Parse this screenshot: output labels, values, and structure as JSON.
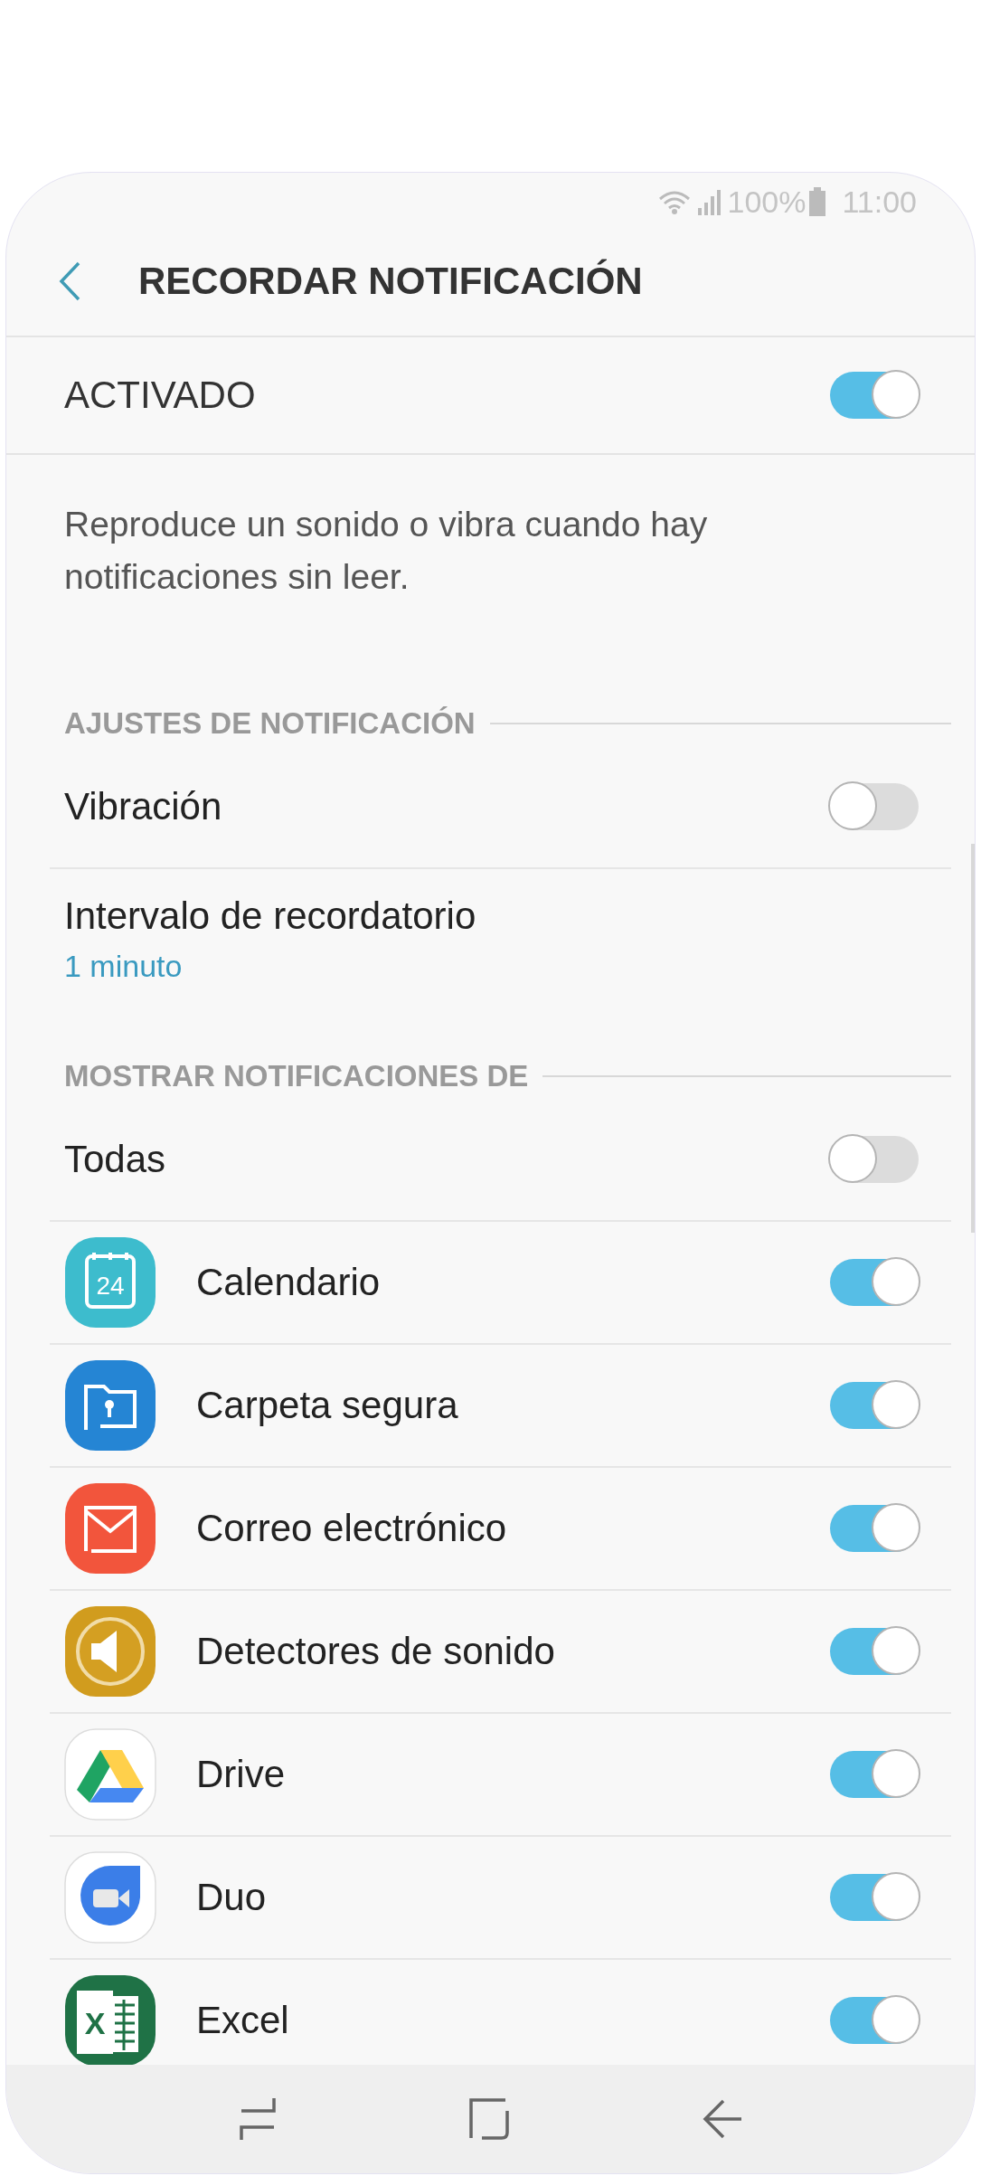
{
  "status_bar": {
    "battery": "100%",
    "time": "11:00"
  },
  "header": {
    "title": "RECORDAR NOTIFICACIÓN"
  },
  "master": {
    "label": "ACTIVADO",
    "on": true
  },
  "description": "Reproduce un sonido o vibra cuando hay notificaciones sin leer.",
  "sections": [
    {
      "title": "AJUSTES DE NOTIFICACIÓN",
      "items": [
        {
          "kind": "switch",
          "label": "Vibración",
          "on": false
        },
        {
          "kind": "value",
          "label": "Intervalo de recordatorio",
          "value": "1 minuto"
        }
      ]
    },
    {
      "title": "MOSTRAR NOTIFICACIONES DE",
      "items": [
        {
          "kind": "switch",
          "label": "Todas",
          "on": false
        },
        {
          "kind": "app",
          "label": "Calendario",
          "on": true,
          "badge": "24"
        },
        {
          "kind": "app",
          "label": "Carpeta segura",
          "on": true
        },
        {
          "kind": "app",
          "label": "Correo electrónico",
          "on": true
        },
        {
          "kind": "app",
          "label": "Detectores de sonido",
          "on": true
        },
        {
          "kind": "app",
          "label": "Drive",
          "on": true
        },
        {
          "kind": "app",
          "label": "Duo",
          "on": true
        },
        {
          "kind": "app",
          "label": "Excel",
          "on": true,
          "badge": "X"
        }
      ]
    }
  ]
}
